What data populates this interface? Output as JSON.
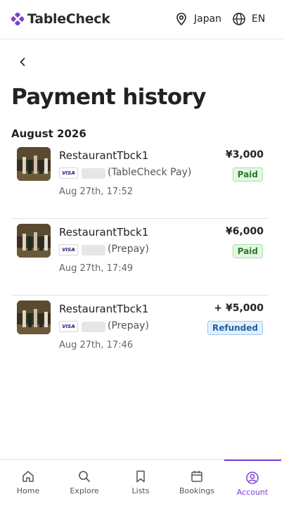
{
  "header": {
    "logo_text": "TableCheck",
    "location": "Japan",
    "language": "EN"
  },
  "page": {
    "title": "Payment history",
    "month": "August 2026"
  },
  "card_brand": "VISA",
  "payments": [
    {
      "restaurant": "RestaurantTbck1",
      "method": "(TableCheck Pay)",
      "time": "Aug 27th, 17:52",
      "amount": "¥3,000",
      "status": "Paid"
    },
    {
      "restaurant": "RestaurantTbck1",
      "method": "(Prepay)",
      "time": "Aug 27th, 17:49",
      "amount": "¥6,000",
      "status": "Paid"
    },
    {
      "restaurant": "RestaurantTbck1",
      "method": "(Prepay)",
      "time": "Aug 27th, 17:46",
      "amount": "+ ¥5,000",
      "status": "Refunded"
    }
  ],
  "nav": {
    "items": [
      {
        "label": "Home",
        "icon": "home-icon"
      },
      {
        "label": "Explore",
        "icon": "search-icon"
      },
      {
        "label": "Lists",
        "icon": "bookmark-icon"
      },
      {
        "label": "Bookings",
        "icon": "calendar-icon"
      },
      {
        "label": "Account",
        "icon": "account-icon"
      }
    ],
    "active": "Account"
  },
  "colors": {
    "brand": "#7b3fd3",
    "paid_bg": "#e3f8e3",
    "paid_text": "#2b7a2b",
    "refunded_bg": "#e3f0fc",
    "refunded_text": "#1f62a6"
  }
}
